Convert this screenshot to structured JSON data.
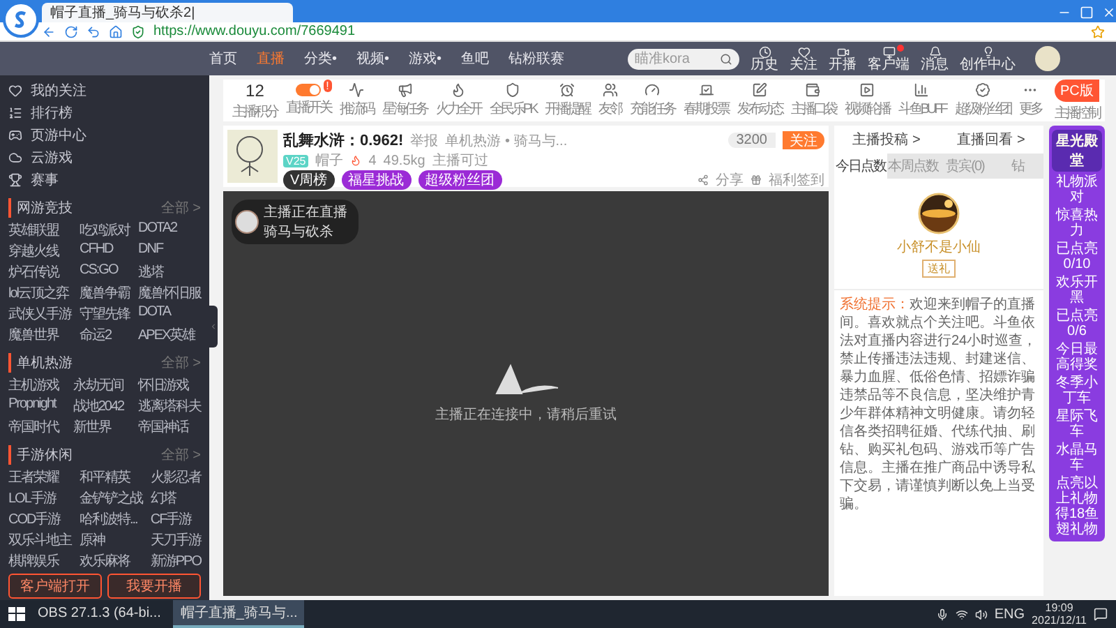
{
  "browser": {
    "tab_title": "帽子直播_骑马与砍杀2|",
    "url": "https://www.douyu.com/7669491"
  },
  "header": {
    "nav": [
      {
        "label": "首页",
        "selected": false
      },
      {
        "label": "直播",
        "selected": true
      },
      {
        "label": "分类•",
        "selected": false
      },
      {
        "label": "视频•",
        "selected": false
      },
      {
        "label": "游戏•",
        "selected": false
      },
      {
        "label": "鱼吧",
        "selected": false
      },
      {
        "label": "钻粉联赛",
        "selected": false
      }
    ],
    "search": {
      "placeholder": "瞄准kora"
    },
    "actions": [
      {
        "label": "历史",
        "badge": false
      },
      {
        "label": "关注",
        "badge": false
      },
      {
        "label": "开播",
        "badge": false
      },
      {
        "label": "客户端",
        "badge": true
      },
      {
        "label": "消息",
        "badge": false
      },
      {
        "label": "创作中心",
        "badge": false
      }
    ]
  },
  "sidebar": {
    "nav": [
      {
        "label": "我的关注"
      },
      {
        "label": "排行榜"
      },
      {
        "label": "页游中心"
      },
      {
        "label": "云游戏"
      },
      {
        "label": "赛事"
      }
    ],
    "sections": [
      {
        "title": "网游竞技",
        "more": "全部 >",
        "items": [
          "英雄联盟",
          "吃鸡派对",
          "DOTA2",
          "穿越火线",
          "CFHD",
          "DNF",
          "炉石传说",
          "CS:GO",
          "逃塔",
          "lol云顶之弈",
          "魔兽争霸",
          "魔兽怀旧服",
          "武侠乂手游",
          "守望先锋",
          "DOTA",
          "魔兽世界",
          "命运2",
          "APEX英雄"
        ]
      },
      {
        "title": "单机热游",
        "more": "全部 >",
        "items": [
          "主机游戏",
          "永劫无间",
          "怀旧游戏",
          "Propnight",
          "战地2042",
          "逃离塔科夫",
          "帝国时代",
          "新世界",
          "帝国神话"
        ]
      },
      {
        "title": "手游休闲",
        "more": "全部 >",
        "items": [
          "王者荣耀",
          "和平精英",
          "火影忍者",
          "LOL手游",
          "金铲铲之战",
          "幻塔",
          "COD手游",
          "哈利波特...",
          "CF手游",
          "双乐斗地主",
          "原神",
          "天刀手游",
          "棋牌娱乐",
          "欢乐麻将",
          "新游PPO"
        ]
      }
    ],
    "buttons": [
      "客户端打开",
      "我要开播"
    ]
  },
  "toolbar": {
    "score": {
      "value": "12",
      "label": "主播积分"
    },
    "items": [
      {
        "kind": "toggle",
        "label": "直播开关",
        "on": true,
        "badge": "!"
      },
      {
        "kind": "icon",
        "label": "推流码"
      },
      {
        "kind": "icon",
        "label": "星海任务"
      },
      {
        "kind": "icon",
        "label": "火力全开"
      },
      {
        "kind": "icon",
        "label": "全民乐PK"
      },
      {
        "kind": "icon",
        "label": "开播提醒"
      },
      {
        "kind": "icon",
        "label": "友邻"
      },
      {
        "kind": "icon",
        "label": "充能任务"
      },
      {
        "kind": "icon",
        "label": "春期投票"
      },
      {
        "kind": "icon",
        "label": "发布动态"
      },
      {
        "kind": "icon",
        "label": "主播口袋"
      },
      {
        "kind": "icon",
        "label": "视频轮播"
      },
      {
        "kind": "icon",
        "label": "斗鱼BUFF"
      },
      {
        "kind": "icon",
        "label": "超级粉丝团"
      },
      {
        "kind": "icon",
        "label": "更多"
      }
    ],
    "pc_button": "PC版",
    "pc_caption": "主播控制"
  },
  "room": {
    "title": "乱舞水浒：0.962!",
    "report": "举报",
    "category": "单机热游 • 骑马与...",
    "level": "V25",
    "streamer": "帽子",
    "hot": "4",
    "weight": "49.5kg",
    "status": "主播可过",
    "badges": [
      "V周榜",
      "福星挑战",
      "超级粉丝团"
    ],
    "follow_count": "3200",
    "follow": "关注",
    "links": [
      "分享",
      "福利签到"
    ]
  },
  "player": {
    "overlay_line1": "主播正在直播",
    "overlay_line2": "骑马与砍杀",
    "status": "主播正在连接中，请稍后重试"
  },
  "rank": {
    "links": [
      "主播投稿 >",
      "直播回看 >"
    ],
    "tabs": [
      {
        "label": "今日点数",
        "selected": true
      },
      {
        "label": "本周点数",
        "selected": false
      },
      {
        "label": "贵宾(0)",
        "selected": false
      },
      {
        "label": "钻",
        "selected": false
      }
    ],
    "top_name": "小舒不是小仙",
    "top_tag": "送礼",
    "notice_label": "系统提示：",
    "notice": "欢迎来到帽子的直播间。喜欢就点个关注吧。斗鱼依法对直播内容进行24小时巡查，禁止传播违法违规、封建迷信、暴力血腥、低俗色情、招嫖诈骗违禁品等不良信息，坚决维护青少年群体精神文明健康。请勿轻信各类招聘征婚、代练代抽、刷钻、购买礼包码、游戏币等广告信息。主播在推广商品中诱导私下交易，请谨慎判断以免上当受骗。"
  },
  "promo": {
    "title": "星光殿堂",
    "head": "礼物派对",
    "gifts": [
      {
        "name": "惊喜热力",
        "progress": "已点亮0/10"
      },
      {
        "name": "欢乐开黑",
        "progress": "已点亮0/6"
      }
    ],
    "sub": "今日最高得奖",
    "rides": [
      "冬季小丁车",
      "星际飞车",
      "水晶马车"
    ],
    "footer": "点亮以上礼物得18鱼翅礼物"
  },
  "taskbar": {
    "apps": [
      {
        "label": "OBS 27.1.3 (64-bi...",
        "selected": false
      },
      {
        "label": "帽子直播_骑马与...",
        "selected": true
      }
    ],
    "lang": "ENG",
    "time": "19:09",
    "date": "2021/12/11"
  }
}
